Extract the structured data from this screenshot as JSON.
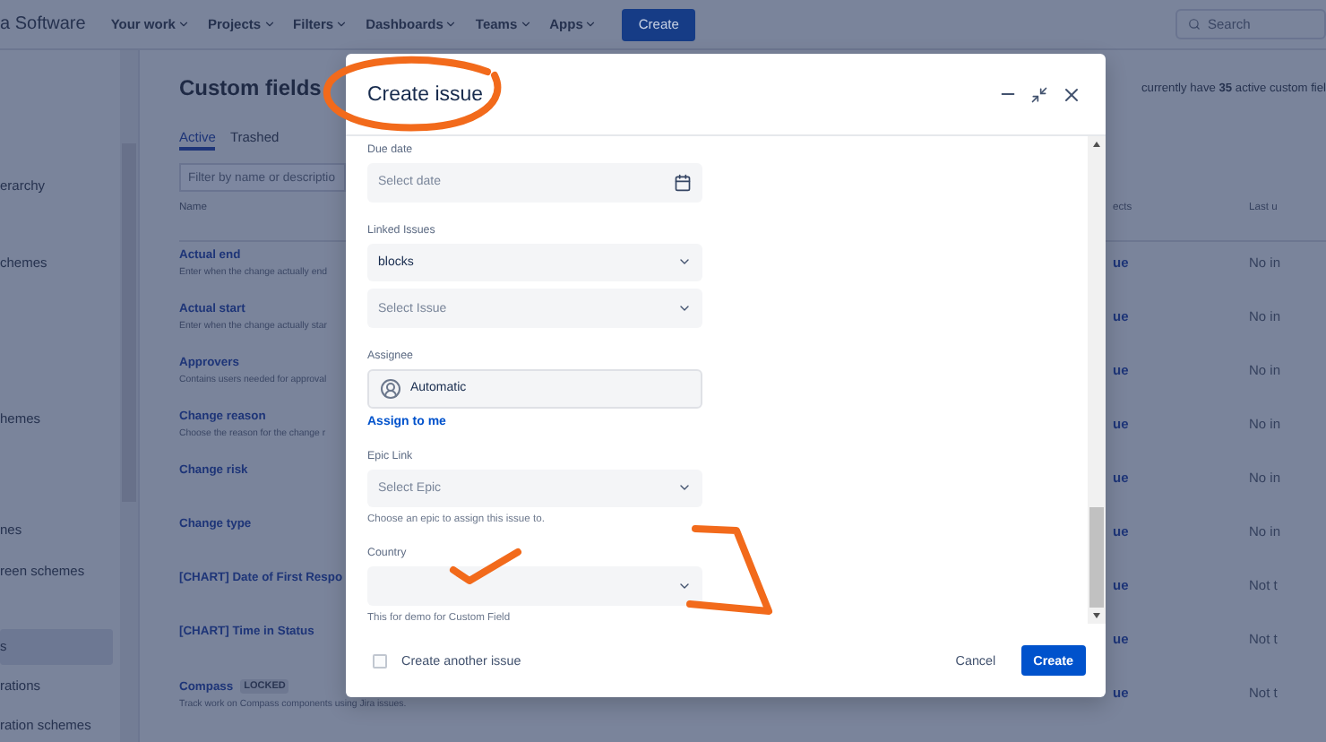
{
  "nav": {
    "brand": "a Software",
    "items": [
      {
        "label": "Your work"
      },
      {
        "label": "Projects"
      },
      {
        "label": "Filters"
      },
      {
        "label": "Dashboards"
      },
      {
        "label": "Teams"
      },
      {
        "label": "Apps"
      }
    ],
    "create": "Create",
    "search": {
      "placeholder": "Search"
    }
  },
  "sidebar": {
    "items": [
      {
        "label": "erarchy",
        "selected": false
      },
      {
        "label": "chemes",
        "selected": false
      },
      {
        "label": "hemes",
        "selected": false
      },
      {
        "label": "nes",
        "selected": false
      },
      {
        "label": "reen schemes",
        "selected": false
      },
      {
        "label": "s",
        "selected": true
      },
      {
        "label": "rations",
        "selected": false
      },
      {
        "label": "ration schemes",
        "selected": false
      }
    ]
  },
  "page": {
    "title": "Custom fields",
    "summary": "currently have **35** active custom fiel",
    "tabs": [
      {
        "label": "Active",
        "selected": true
      },
      {
        "label": "Trashed",
        "selected": false
      }
    ],
    "filter": {
      "placeholder": "Filter by name or descriptio"
    },
    "columns": [
      "Name",
      "ects",
      "Last u"
    ],
    "rows": [
      {
        "name": "Actual end",
        "description": "Enter when the change actually end",
        "projects": "ue",
        "last_used": "No in"
      },
      {
        "name": "Actual start",
        "description": "Enter when the change actually star",
        "projects": "ue",
        "last_used": "No in"
      },
      {
        "name": "Approvers",
        "description": "Contains users needed for approval",
        "projects": "ue",
        "last_used": "No in"
      },
      {
        "name": "Change reason",
        "description": "Choose the reason for the change r",
        "projects": "ue",
        "last_used": "No in"
      },
      {
        "name": "Change risk",
        "projects": "ue",
        "last_used": "No in"
      },
      {
        "name": "Change type",
        "projects": "ue",
        "last_used": "No in"
      },
      {
        "name": "[CHART] Date of First Respo",
        "projects": "ue",
        "last_used": "Not t"
      },
      {
        "name": "[CHART] Time in Status",
        "projects": "ue",
        "last_used": "Not t"
      },
      {
        "name": "Compass",
        "badge": "LOCKED",
        "description": "Track work on Compass components using Jira issues.",
        "projects": "ue",
        "last_used": "Not t"
      }
    ]
  },
  "dialog": {
    "title": "Create issue",
    "fields": [
      {
        "kind": "date",
        "label": "Due date",
        "placeholder": "Select date"
      },
      {
        "kind": "select",
        "label": "Linked Issues",
        "value": "blocks"
      },
      {
        "kind": "select",
        "placeholder": "Select Issue"
      },
      {
        "kind": "user",
        "label": "Assignee",
        "value": "Automatic",
        "link": "Assign to me"
      },
      {
        "kind": "select",
        "label": "Epic Link",
        "placeholder": "Select Epic",
        "help": "Choose an epic to assign this issue to."
      },
      {
        "kind": "select",
        "label": "Country",
        "help": "This for demo for Custom Field"
      }
    ],
    "create_another": {
      "label": "Create another issue",
      "checked": false
    },
    "cancel": "Cancel",
    "create": "Create"
  }
}
